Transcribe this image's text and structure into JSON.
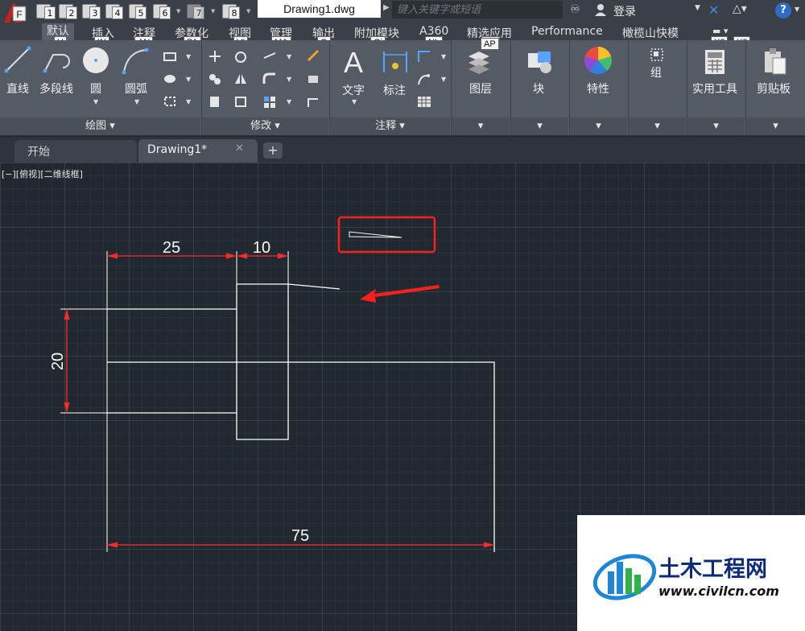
{
  "titlebar": {
    "document_title": "Drawing1.dwg",
    "search_placeholder": "键入关键字或短语",
    "login_label": "登录",
    "app_menu_keytip": "F",
    "quick_access_keytips": [
      "1",
      "2",
      "3",
      "4",
      "5",
      "6",
      "7",
      "8"
    ]
  },
  "ribbon_tabs": [
    {
      "label": "默认",
      "keytip": "H"
    },
    {
      "label": "插入",
      "keytip": "IN"
    },
    {
      "label": "注释",
      "keytip": "AN"
    },
    {
      "label": "参数化",
      "keytip": "PA"
    },
    {
      "label": "视图",
      "keytip": "VI"
    },
    {
      "label": "管理",
      "keytip": "MA"
    },
    {
      "label": "输出",
      "keytip": "O"
    },
    {
      "label": "附加模块",
      "keytip": "Gi"
    },
    {
      "label": "A360",
      "keytip": "NL"
    },
    {
      "label": "精选应用",
      "keytip": "AP"
    },
    {
      "label": "Performance",
      "keytip": ""
    },
    {
      "label": "橄榄山快模",
      "keytip": ""
    }
  ],
  "ribbon_extra_keytips": [
    "X2",
    "X3"
  ],
  "ribbon": {
    "draw": {
      "panel_title": "绘图",
      "line_label": "直线",
      "polyline_label": "多段线",
      "circle_label": "圆",
      "arc_label": "圆弧"
    },
    "modify": {
      "panel_title": "修改"
    },
    "annotation": {
      "panel_title": "注释",
      "text_label": "文字",
      "dimension_label": "标注"
    },
    "layers_label": "图层",
    "block_label": "块",
    "properties_label": "特性",
    "group_label": "组",
    "utilities_label": "实用工具",
    "clipboard_label": "剪贴板"
  },
  "file_tabs": {
    "start_label": "开始",
    "drawing_label": "Drawing1*",
    "close_symbol": "✕",
    "add_symbol": "+"
  },
  "viewport_label": "[−][俯视][二维线框]",
  "dimensions": {
    "d25": "25",
    "d10": "10",
    "d20": "20",
    "d75": "75"
  },
  "watermark": {
    "name": "土木工程网",
    "url": "www.civilcn.com"
  },
  "colors": {
    "dimension": "#ff2a2a",
    "geometry": "#ffffff",
    "highlight": "#ff1f1f",
    "canvas": "#212830"
  }
}
